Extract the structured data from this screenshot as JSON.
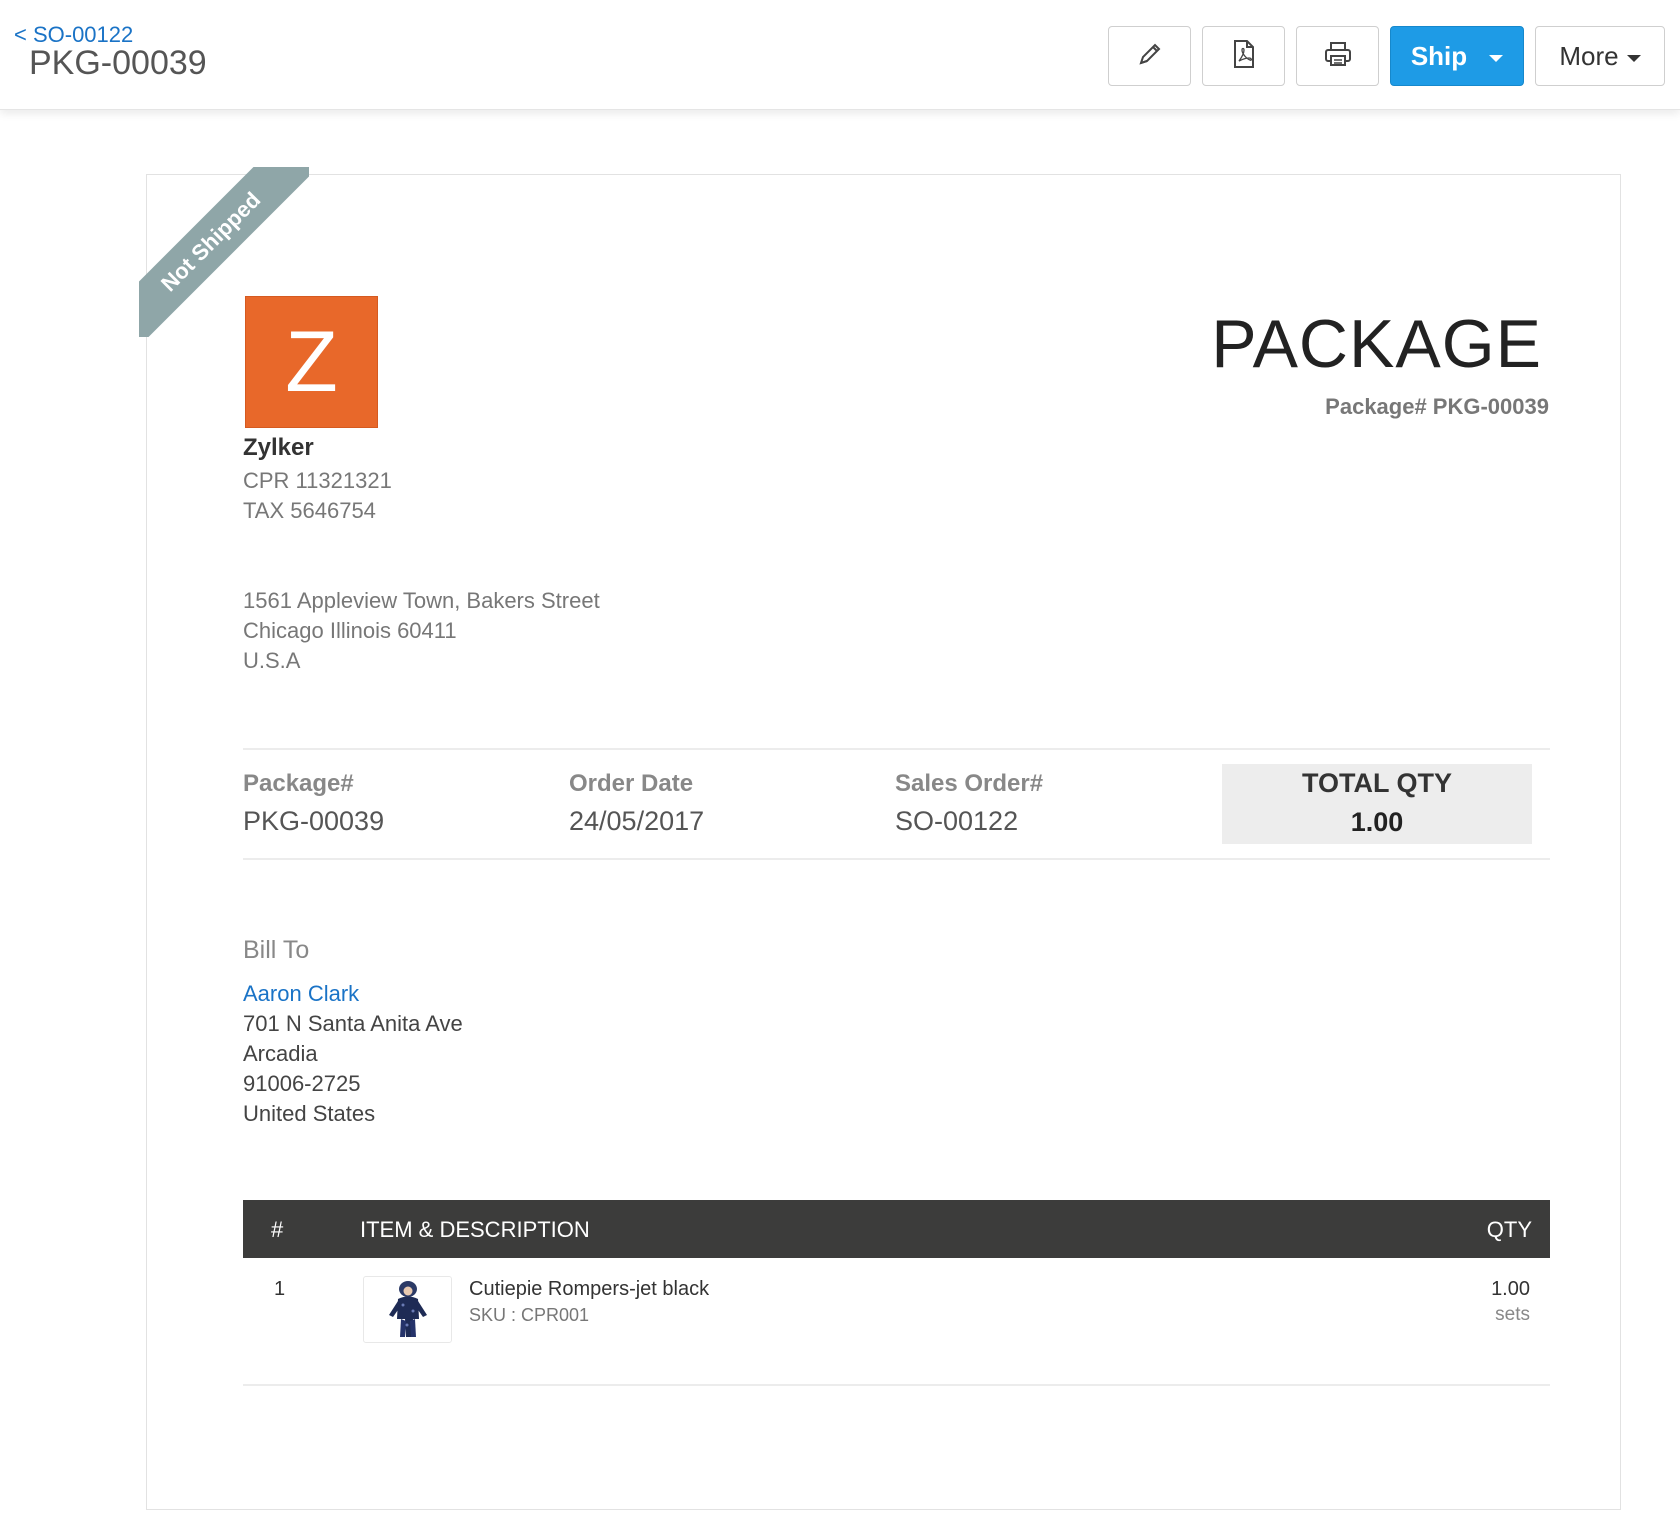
{
  "header": {
    "back_link": "< SO-00122",
    "title": "PKG-00039",
    "toolbar": {
      "edit_icon": "pencil-icon",
      "pdf_icon": "pdf-icon",
      "print_icon": "printer-icon",
      "ship_label": "Ship",
      "more_label": "More"
    }
  },
  "document": {
    "status_ribbon": "Not Shipped",
    "logo_letter": "Z",
    "company": {
      "name": "Zylker",
      "lines": [
        "CPR 11321321",
        "TAX 5646754"
      ],
      "address": [
        "1561 Appleview Town, Bakers Street",
        "Chicago Illinois 60411",
        "U.S.A"
      ]
    },
    "title": "PACKAGE",
    "number_line": "Package# PKG-00039",
    "meta": {
      "package_label": "Package#",
      "package_value": "PKG-00039",
      "order_date_label": "Order Date",
      "order_date_value": "24/05/2017",
      "sales_order_label": "Sales Order#",
      "sales_order_value": "SO-00122",
      "total_qty_label": "TOTAL QTY",
      "total_qty_value": "1.00"
    },
    "bill_to": {
      "title": "Bill To",
      "name": "Aaron Clark",
      "lines": [
        "701 N Santa Anita Ave",
        "Arcadia",
        "91006-2725",
        "United States"
      ]
    },
    "table": {
      "columns": [
        "#",
        "ITEM & DESCRIPTION",
        "QTY"
      ],
      "rows": [
        {
          "num": "1",
          "name": "Cutiepie Rompers-jet black",
          "sku": "SKU : CPR001",
          "qty": "1.00",
          "unit": "sets"
        }
      ]
    }
  },
  "colors": {
    "accent": "#1e9be6",
    "link": "#1a73c6",
    "logo": "#e8682a",
    "ribbon": "#8fa6a8",
    "table_header": "#3c3c3b"
  }
}
